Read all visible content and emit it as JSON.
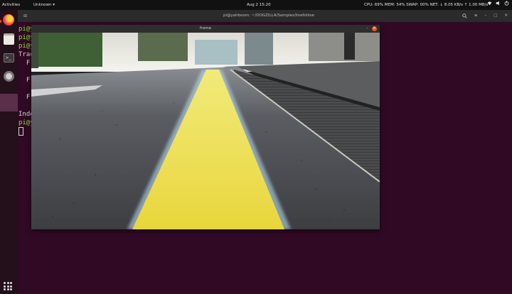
{
  "topbar": {
    "activities": "Activities",
    "app_menu": "Unknown ▾",
    "clock": "Aug 2  15:20",
    "system_monitor": "CPU: 69% MEM: 54%  SWAP: 00% NET: ↓  8.05 KB/s ↑  1.00 MB/s"
  },
  "terminal": {
    "title": "pi@yahboom: ~/DOGZILLA/Samples/linefollow",
    "lines": [
      {
        "text": "pi@y",
        "kind": "prompt"
      },
      {
        "text": "pi@y",
        "kind": "prompt"
      },
      {
        "text": "pi@y",
        "kind": "prompt"
      },
      {
        "text": "Trac",
        "kind": "out"
      },
      {
        "text": "  F",
        "kind": "out"
      },
      {
        "text": "",
        "kind": "out"
      },
      {
        "text": "  F",
        "kind": "out"
      },
      {
        "text": "",
        "kind": "out"
      },
      {
        "text": "  F",
        "kind": "out"
      },
      {
        "text": "",
        "kind": "out"
      },
      {
        "text": "Inde",
        "kind": "out"
      },
      {
        "text": "pi@y",
        "kind": "prompt"
      }
    ]
  },
  "frame": {
    "title": "frame"
  },
  "colors": {
    "accent": "#e95420",
    "desktop": "#2c0f22",
    "terminal_bg": "#300a24"
  }
}
